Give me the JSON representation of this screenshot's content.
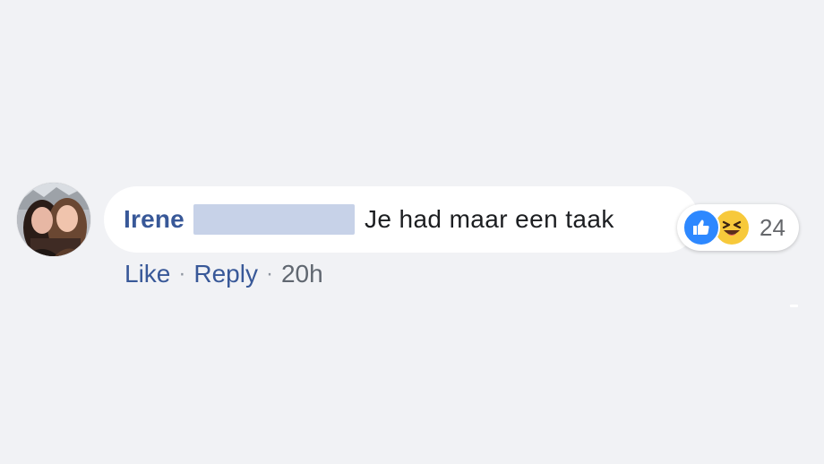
{
  "comment": {
    "author": "Irene",
    "text": "Je had maar een taak",
    "reactions": {
      "icons": [
        "like-icon",
        "haha-icon"
      ],
      "count": "24"
    },
    "actions": {
      "like_label": "Like",
      "reply_label": "Reply",
      "separator": "·",
      "timestamp": "20h"
    }
  },
  "colors": {
    "background": "#f1f2f5",
    "author": "#385898",
    "link": "#385898",
    "text": "#1c1e21",
    "timestamp": "#606770",
    "like": "#2d88ff",
    "haha": "#f7c93b",
    "redaction": "#c7d2e8"
  }
}
